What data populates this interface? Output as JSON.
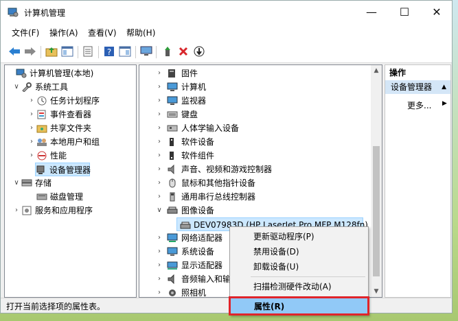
{
  "window": {
    "title": "计算机管理",
    "min": "—",
    "max": "☐",
    "close": "✕"
  },
  "menu": [
    "文件(F)",
    "操作(A)",
    "查看(V)",
    "帮助(H)"
  ],
  "toolbar_icons": [
    "back-arrow",
    "forward-arrow",
    "folder-up",
    "show-hide-tree",
    "export-list",
    "help",
    "properties",
    "monitor",
    "update-driver",
    "disable-device",
    "uninstall-device"
  ],
  "left_tree": [
    {
      "label": "计算机管理(本地)",
      "depth": 0,
      "chev": "",
      "icon": "computer-mgmt"
    },
    {
      "label": "系统工具",
      "depth": 1,
      "chev": "∨",
      "icon": "tools"
    },
    {
      "label": "任务计划程序",
      "depth": 2,
      "chev": "›",
      "icon": "clock"
    },
    {
      "label": "事件查看器",
      "depth": 2,
      "chev": "›",
      "icon": "event-log"
    },
    {
      "label": "共享文件夹",
      "depth": 2,
      "chev": "›",
      "icon": "shared-folder"
    },
    {
      "label": "本地用户和组",
      "depth": 2,
      "chev": "›",
      "icon": "users"
    },
    {
      "label": "性能",
      "depth": 2,
      "chev": "›",
      "icon": "performance"
    },
    {
      "label": "设备管理器",
      "depth": 2,
      "chev": "",
      "icon": "device-manager",
      "selected": true
    },
    {
      "label": "存储",
      "depth": 1,
      "chev": "∨",
      "icon": "storage"
    },
    {
      "label": "磁盘管理",
      "depth": 2,
      "chev": "",
      "icon": "disk"
    },
    {
      "label": "服务和应用程序",
      "depth": 1,
      "chev": "›",
      "icon": "services"
    }
  ],
  "device_tree": [
    {
      "label": "固件",
      "chev": "›",
      "icon": "firmware"
    },
    {
      "label": "计算机",
      "chev": "›",
      "icon": "monitor"
    },
    {
      "label": "监视器",
      "chev": "›",
      "icon": "monitor"
    },
    {
      "label": "键盘",
      "chev": "›",
      "icon": "keyboard"
    },
    {
      "label": "人体学输入设备",
      "chev": "›",
      "icon": "hid"
    },
    {
      "label": "软件设备",
      "chev": "›",
      "icon": "software-device"
    },
    {
      "label": "软件组件",
      "chev": "›",
      "icon": "software-component"
    },
    {
      "label": "声音、视频和游戏控制器",
      "chev": "›",
      "icon": "speaker"
    },
    {
      "label": "鼠标和其他指针设备",
      "chev": "›",
      "icon": "mouse"
    },
    {
      "label": "通用串行总线控制器",
      "chev": "›",
      "icon": "usb"
    },
    {
      "label": "图像设备",
      "chev": "∨",
      "icon": "imaging"
    },
    {
      "label": "DEV07983D (HP LaserJet Pro MFP M128fn)",
      "chev": "",
      "icon": "scanner",
      "child": true,
      "selected": true
    },
    {
      "label": "网络适配器",
      "chev": "›",
      "icon": "network"
    },
    {
      "label": "系统设备",
      "chev": "›",
      "icon": "system-device"
    },
    {
      "label": "显示适配器",
      "chev": "›",
      "icon": "display-adapter"
    },
    {
      "label": "音频输入和输出",
      "chev": "›",
      "icon": "audio"
    },
    {
      "label": "照相机",
      "chev": "›",
      "icon": "camera"
    }
  ],
  "actions": {
    "header": "操作",
    "section": "设备管理器",
    "more": "更多..."
  },
  "context_menu": {
    "items": [
      "更新驱动程序(P)",
      "禁用设备(D)",
      "卸载设备(U)",
      "扫描检测硬件改动(A)",
      "属性(R)"
    ],
    "highlighted": "属性(R)"
  },
  "status": "打开当前选择项的属性表。",
  "colors": {
    "highlight": "#91c9f7",
    "annotation_box": "#e0242a",
    "selection": "#cce8ff"
  }
}
